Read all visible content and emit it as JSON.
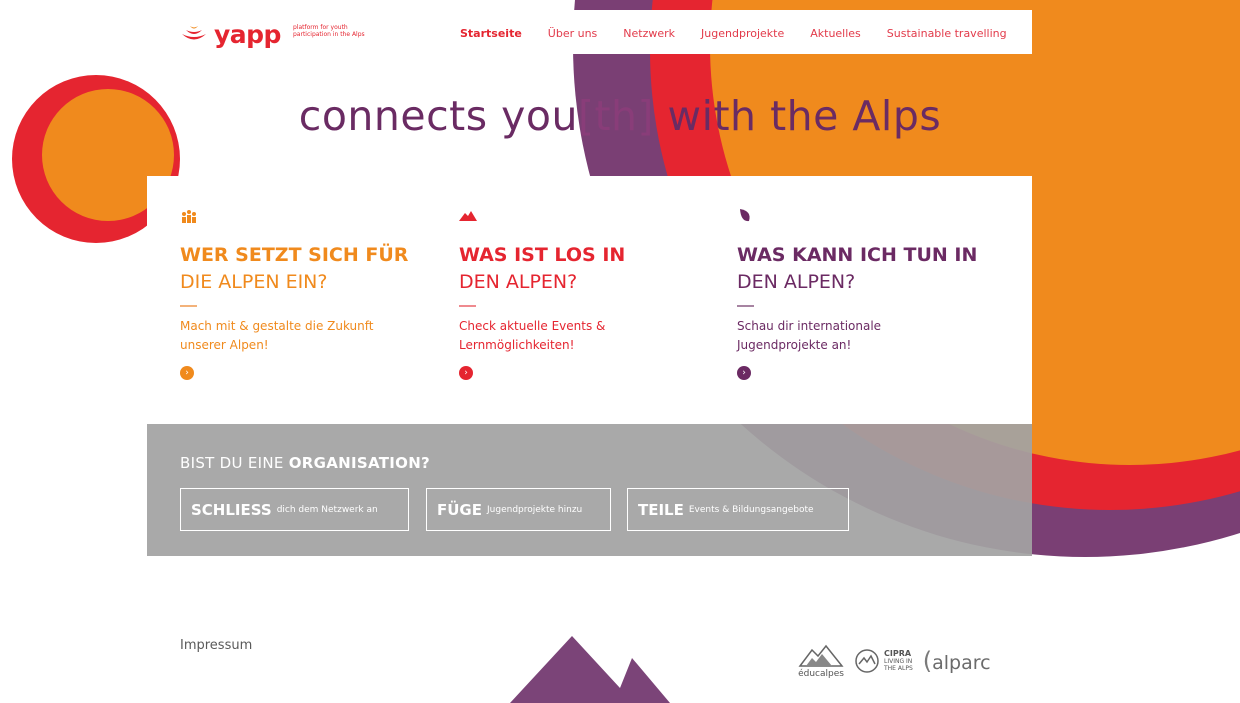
{
  "brand": {
    "name": "yapp",
    "tagline": "platform for youth\nparticipation in the Alps",
    "color": "#e52530"
  },
  "nav": {
    "items": [
      {
        "label": "Startseite",
        "active": true
      },
      {
        "label": "Über uns",
        "active": false
      },
      {
        "label": "Netzwerk",
        "active": false
      },
      {
        "label": "Jugendprojekte",
        "active": false
      },
      {
        "label": "Aktuelles",
        "active": false
      },
      {
        "label": "Sustainable travelling",
        "active": false
      }
    ]
  },
  "headline": {
    "pre": "connects you",
    "bracket": "[th]",
    "post": " with the Alps"
  },
  "cards": [
    {
      "icon": "people-icon",
      "title_bold": "WER SETZT SICH FÜR",
      "title_light": "DIE ALPEN EIN?",
      "description": "Mach mit & gestalte die Zukunft\nunserer Alpen!",
      "color": "#f08a1d"
    },
    {
      "icon": "mountain-icon",
      "title_bold": "WAS IST LOS IN",
      "title_light": "DEN ALPEN?",
      "description": "Check aktuelle Events &\nLernmöglichkeiten!",
      "color": "#e52530"
    },
    {
      "icon": "leaf-icon",
      "title_bold": "WAS KANN ICH TUN IN",
      "title_light": "DEN ALPEN?",
      "description": "Schau dir internationale\nJugendprojekte an!",
      "color": "#6b2a63"
    }
  ],
  "organisation": {
    "title_light": "BIST DU EINE ",
    "title_bold": "ORGANISATION?",
    "buttons": [
      {
        "bold": "SCHLIESS",
        "small": "dich dem Netzwerk an"
      },
      {
        "bold": "FÜGE",
        "small": "Jugendprojekte hinzu"
      },
      {
        "bold": "TEILE",
        "small": "Events & Bildungsangebote"
      }
    ]
  },
  "footer": {
    "impressum": "Impressum",
    "partners": {
      "educalpes": "éducalpes",
      "cipra_name": "CIPRA",
      "cipra_sub": "LIVING IN\nTHE ALPS",
      "alparc": "alparc"
    }
  },
  "colors": {
    "orange": "#f08a1d",
    "red": "#e52530",
    "purple": "#6b2a63",
    "grey_panel": "#a3a3a3"
  }
}
